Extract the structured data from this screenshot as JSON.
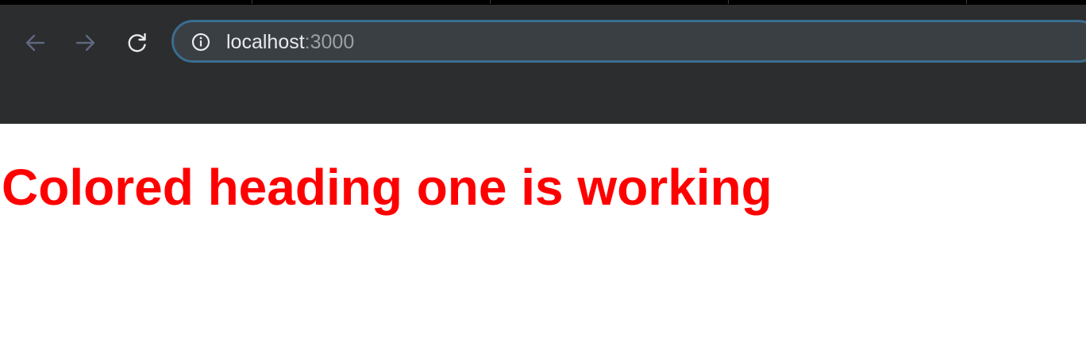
{
  "browser": {
    "address_bar": {
      "host": "localhost",
      "port": ":3000"
    },
    "icons": {
      "back": "arrow-left-icon",
      "forward": "arrow-right-icon",
      "reload": "reload-icon",
      "site_info": "info-icon"
    },
    "colors": {
      "toolbar_bg": "#2b2d2e",
      "omnibox_bg": "#3a3f44",
      "omnibox_border": "#3a6d8f"
    }
  },
  "page": {
    "heading": "Colored heading one is working",
    "heading_color": "#ff0000"
  }
}
